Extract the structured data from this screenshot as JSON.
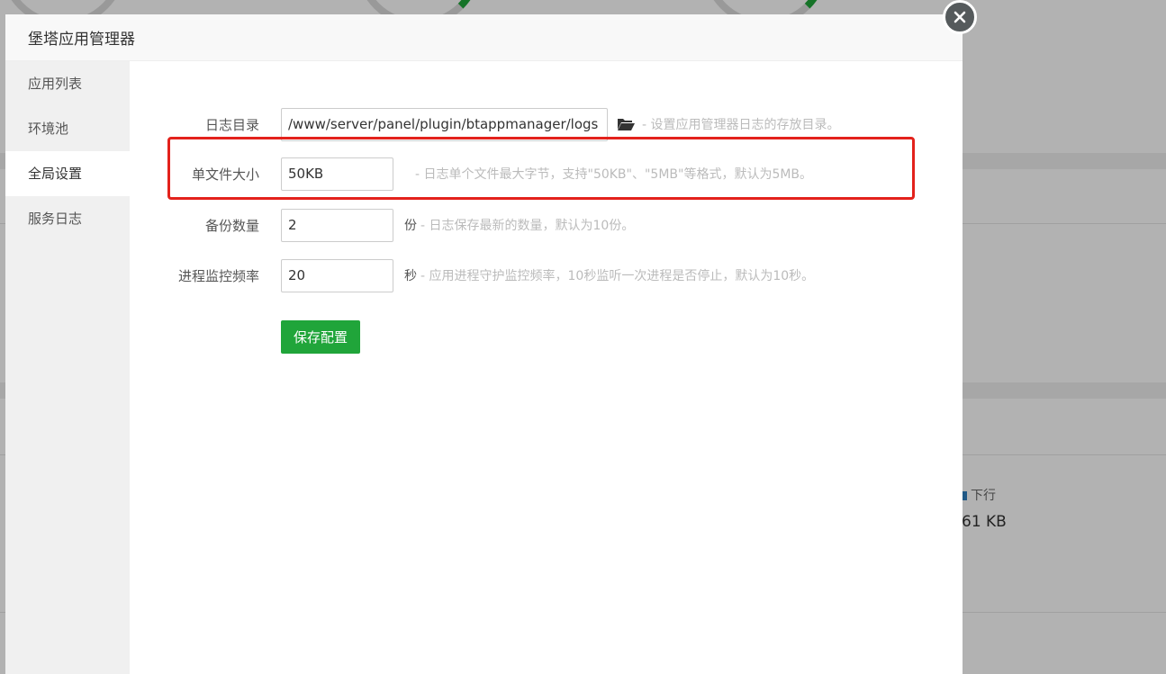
{
  "modal": {
    "title": "堡塔应用管理器",
    "close_icon": "close-icon"
  },
  "sidebar": {
    "items": [
      {
        "label": "应用列表",
        "active": false
      },
      {
        "label": "环境池",
        "active": false
      },
      {
        "label": "全局设置",
        "active": true
      },
      {
        "label": "服务日志",
        "active": false
      }
    ]
  },
  "settings": {
    "log_dir": {
      "label": "日志目录",
      "value": "/www/server/panel/plugin/btappmanager/logs",
      "icon": "folder-open-icon",
      "hint": " - 设置应用管理器日志的存放目录。"
    },
    "file_size": {
      "label": "单文件大小",
      "value": "50KB",
      "hint": " - 日志单个文件最大字节，支持\"50KB\"、\"5MB\"等格式，默认为5MB。"
    },
    "backup_count": {
      "label": "备份数量",
      "value": "2",
      "unit": "份",
      "hint": " - 日志保存最新的数量，默认为10份。"
    },
    "monitor_freq": {
      "label": "进程监控频率",
      "value": "20",
      "unit": "秒",
      "hint": " - 应用进程守护监控频率，10秒监听一次进程是否停止，默认为10秒。"
    },
    "save_label": "保存配置"
  },
  "background": {
    "legend_label": "下行",
    "value": "61 KB"
  },
  "colors": {
    "accent": "#20a53a",
    "highlight": "#e3221c",
    "hint": "#bbbbbb"
  }
}
